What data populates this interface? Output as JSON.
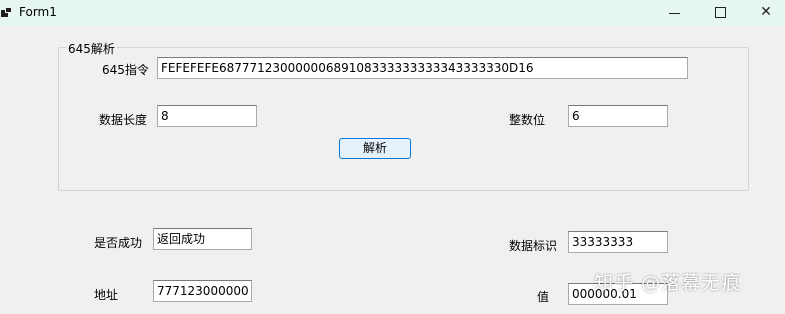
{
  "window": {
    "title": "Form1",
    "controls": {
      "minimize": "—",
      "maximize": "☐",
      "close": "✕"
    }
  },
  "group": {
    "legend": "645解析",
    "command_label": "645指令",
    "command_value": "FEFEFEFE68777123000000689108333333333343333330D16",
    "data_length_label": "数据长度",
    "data_length_value": "8",
    "integer_digits_label": "整数位",
    "integer_digits_value": "6",
    "parse_button": "解析"
  },
  "results": {
    "success_label": "是否成功",
    "success_value": "返回成功",
    "address_label": "地址",
    "address_value": "777123000000",
    "data_id_label": "数据标识",
    "data_id_value": "33333333",
    "value_label": "值",
    "value_value": "000000.01"
  },
  "watermark": "知乎 @落幕无痕",
  "colors": {
    "titlebar": "#e6f6f2",
    "form_bg": "#f0f0f0",
    "button_border": "#0078d7",
    "button_bg": "#e5f1fb"
  }
}
